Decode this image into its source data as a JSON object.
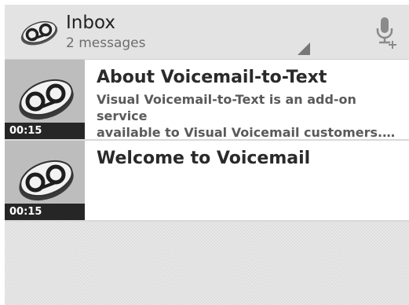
{
  "header": {
    "title": "Inbox",
    "subtitle": "2 messages",
    "app_icon": "voicemail-tape-icon",
    "mic_icon": "add-voice-icon"
  },
  "messages": [
    {
      "title": "About Voicemail-to-Text",
      "snippet": "Visual Voicemail-to-Text is an add-on service\navailable to Visual Voicemail customers.…",
      "duration": "00:15",
      "icon": "voicemail-tape-icon"
    },
    {
      "title": "Welcome to Voicemail",
      "snippet": "",
      "duration": "00:15",
      "icon": "voicemail-tape-icon"
    }
  ],
  "colors": {
    "action_bar": "#e3e3e3",
    "thumb_bg": "#bdbdbd",
    "duration_bg": "#262626",
    "empty_bg": "#e7e7e7"
  }
}
